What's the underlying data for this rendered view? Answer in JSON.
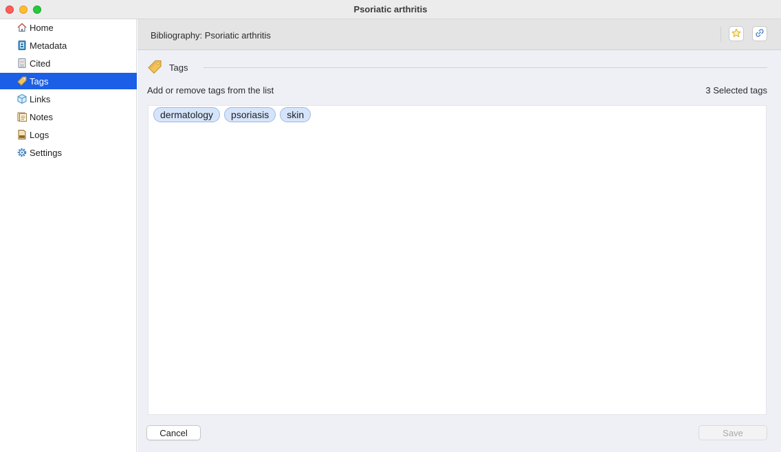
{
  "window": {
    "title": "Psoriatic arthritis"
  },
  "sidebar": {
    "items": [
      {
        "label": "Home",
        "icon": "home-icon",
        "active": false
      },
      {
        "label": "Metadata",
        "icon": "metadata-icon",
        "active": false
      },
      {
        "label": "Cited",
        "icon": "cited-icon",
        "active": false
      },
      {
        "label": "Tags",
        "icon": "tag-icon",
        "active": true
      },
      {
        "label": "Links",
        "icon": "links-cube-icon",
        "active": false
      },
      {
        "label": "Notes",
        "icon": "notes-icon",
        "active": false
      },
      {
        "label": "Logs",
        "icon": "logs-icon",
        "active": false
      },
      {
        "label": "Settings",
        "icon": "gear-icon",
        "active": false
      }
    ]
  },
  "header": {
    "title": "Bibliography: Psoriatic arthritis",
    "buttons": [
      {
        "icon": "star-icon"
      },
      {
        "icon": "link-icon"
      }
    ]
  },
  "section": {
    "title": "Tags",
    "icon": "tag-icon"
  },
  "instructions": "Add or remove tags from the list",
  "selected_count": "3 Selected tags",
  "tags": [
    "dermatology",
    "psoriasis",
    "skin"
  ],
  "footer": {
    "cancel_label": "Cancel",
    "save_label": "Save",
    "save_enabled": false
  },
  "colors": {
    "accent": "#1a5fe5",
    "chip_bg": "#d6e4fb",
    "chip_border": "#9cb7e0",
    "content_bg": "#eef0f6"
  }
}
